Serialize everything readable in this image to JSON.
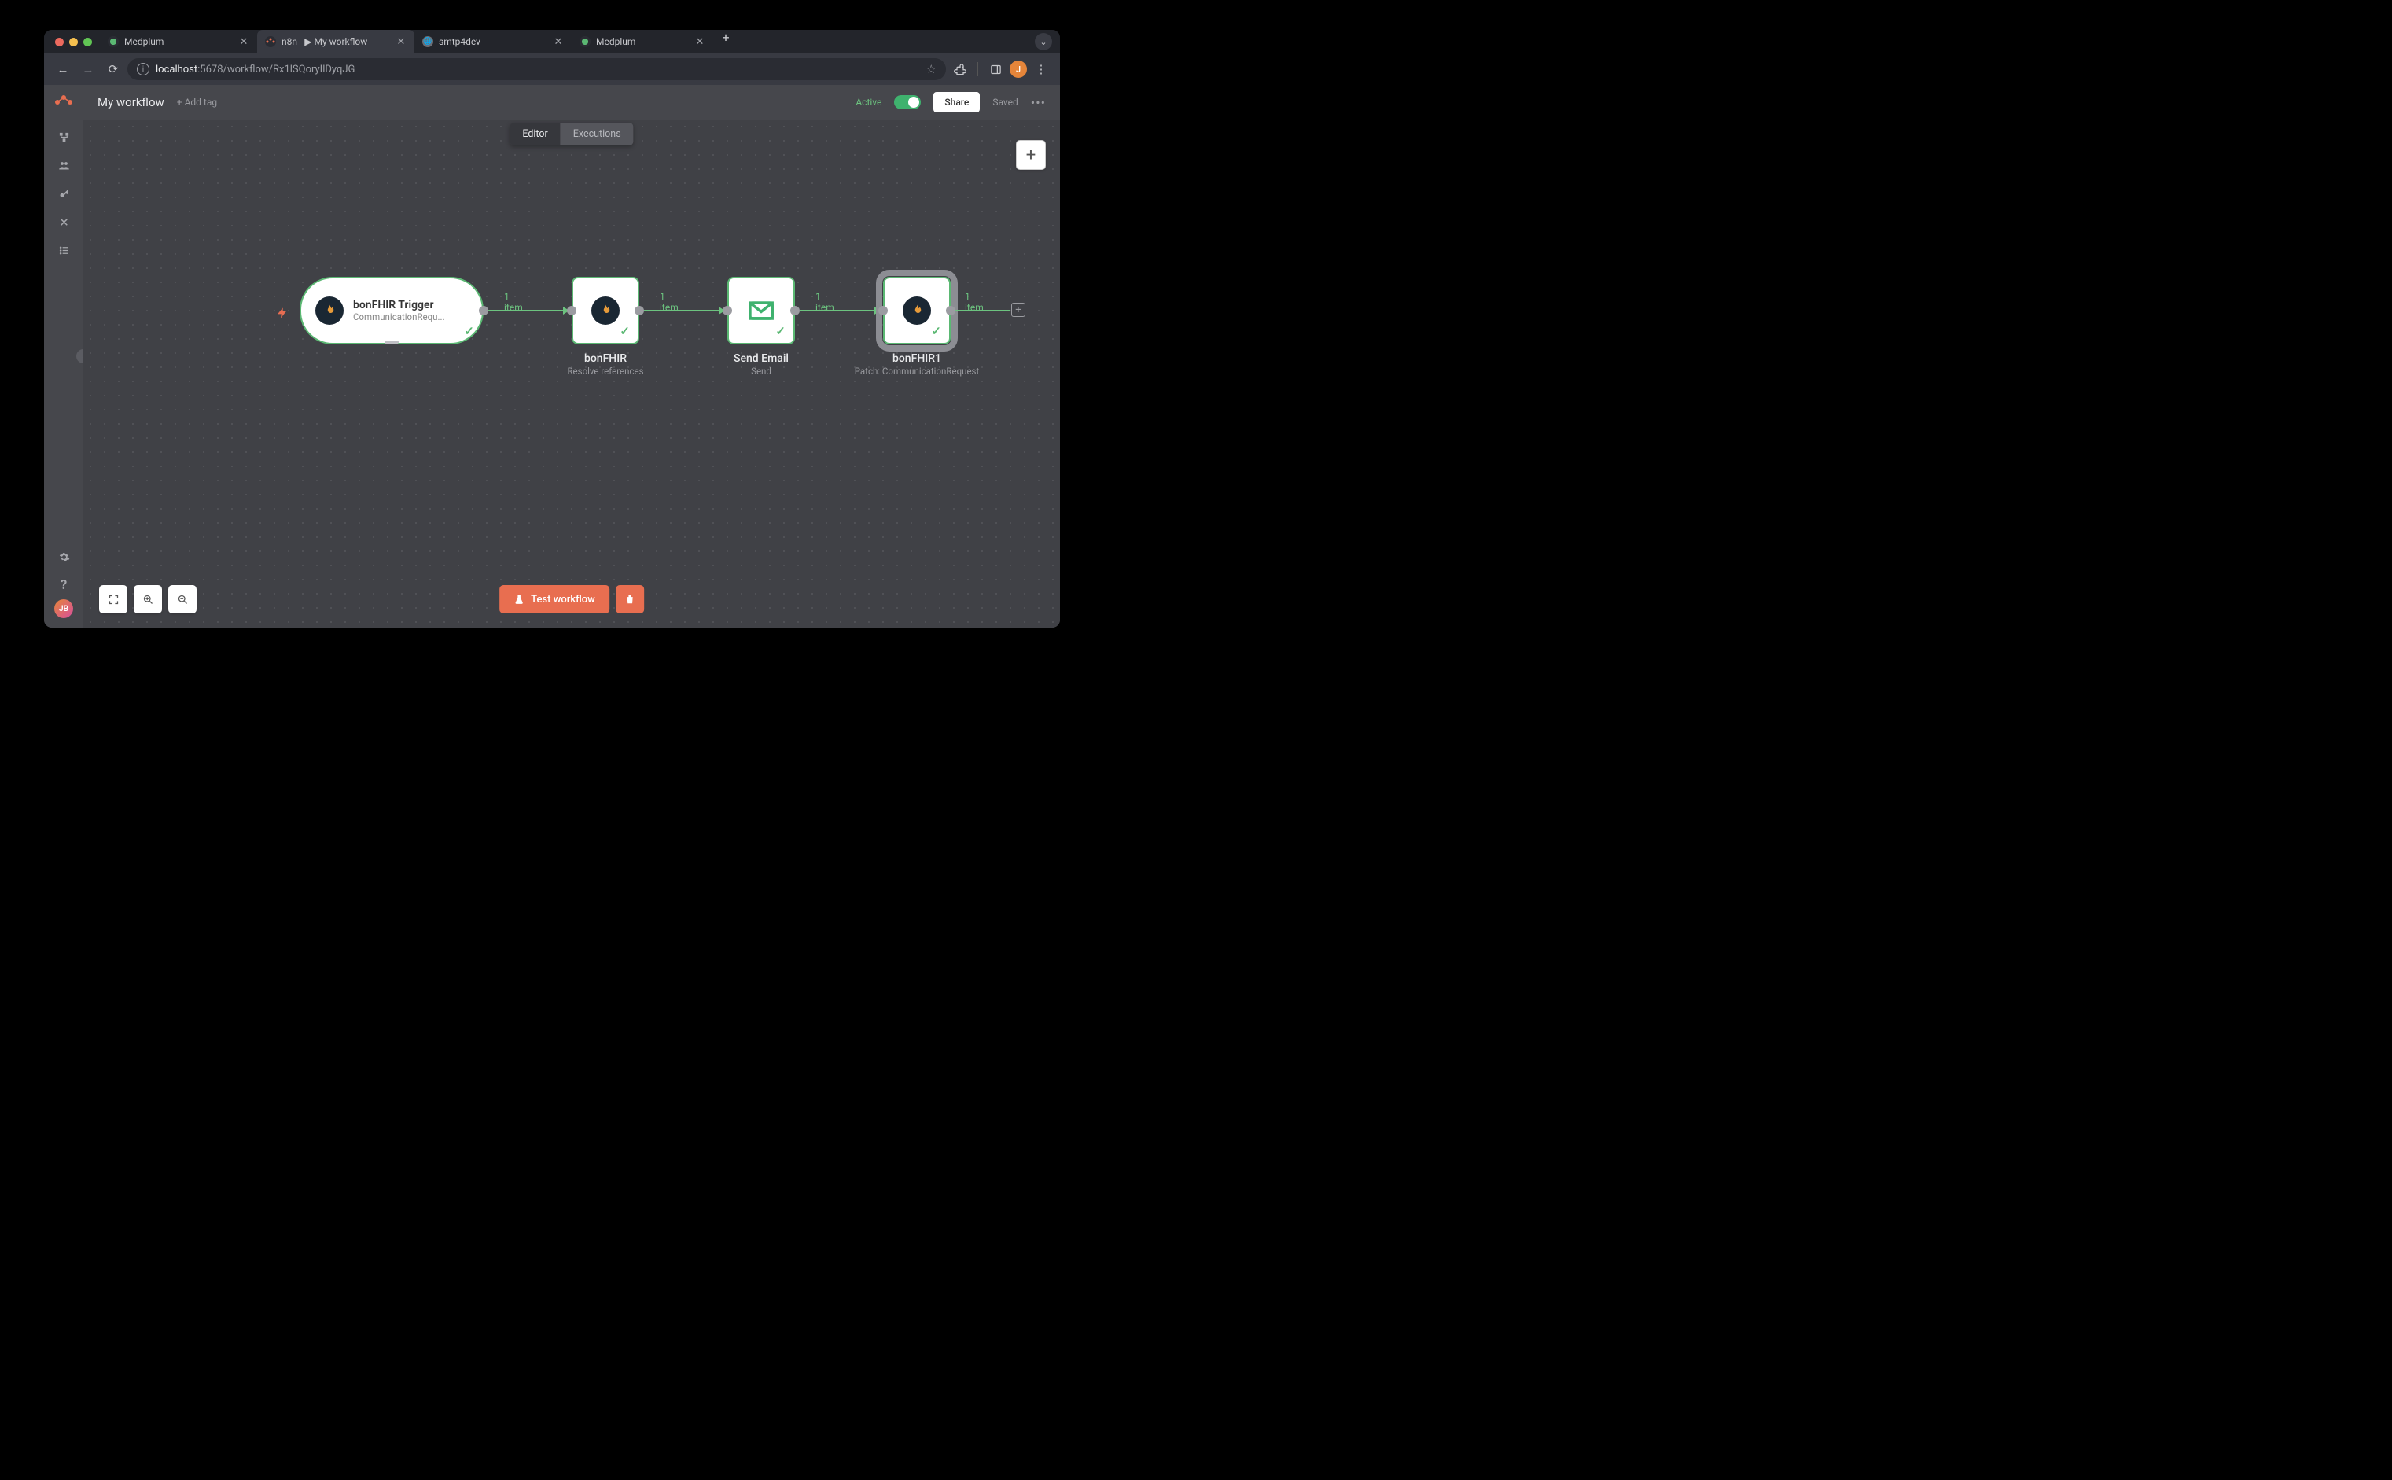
{
  "browser": {
    "tabs": [
      {
        "title": "Medplum",
        "favicon": "medplum"
      },
      {
        "title": "n8n - ▶ My workflow",
        "favicon": "n8n"
      },
      {
        "title": "smtp4dev",
        "favicon": "globe"
      },
      {
        "title": "Medplum",
        "favicon": "medplum"
      }
    ],
    "active_tab_index": 1,
    "url_host": "localhost",
    "url_rest": ":5678/workflow/Rx1lSQoryIlDyqJG",
    "avatar_initial": "J"
  },
  "sidebar": {
    "items": [
      "workflows-icon",
      "team-icon",
      "credentials-icon",
      "variables-icon",
      "checklist-icon"
    ],
    "settings_label": "settings-icon",
    "help_label": "help-icon",
    "avatar_initials": "JB"
  },
  "appbar": {
    "workflow_name": "My workflow",
    "add_tag": "+ Add tag",
    "active_label": "Active",
    "active_state": true,
    "share": "Share",
    "saved": "Saved"
  },
  "viewtabs": {
    "editor": "Editor",
    "executions": "Executions",
    "active": "editor"
  },
  "nodes": {
    "trigger": {
      "title": "bonFHIR Trigger",
      "subtitle": "CommunicationRequ..."
    },
    "n1": {
      "title": "bonFHIR",
      "subtitle": "Resolve references"
    },
    "n2": {
      "title": "Send Email",
      "subtitle": "Send"
    },
    "n3": {
      "title": "bonFHIR1",
      "subtitle": "Patch: CommunicationRequest"
    }
  },
  "connectors": {
    "c1": "1 item",
    "c2": "1 item",
    "c3": "1 item",
    "c4": "1 item"
  },
  "footer": {
    "test_workflow": "Test workflow"
  }
}
